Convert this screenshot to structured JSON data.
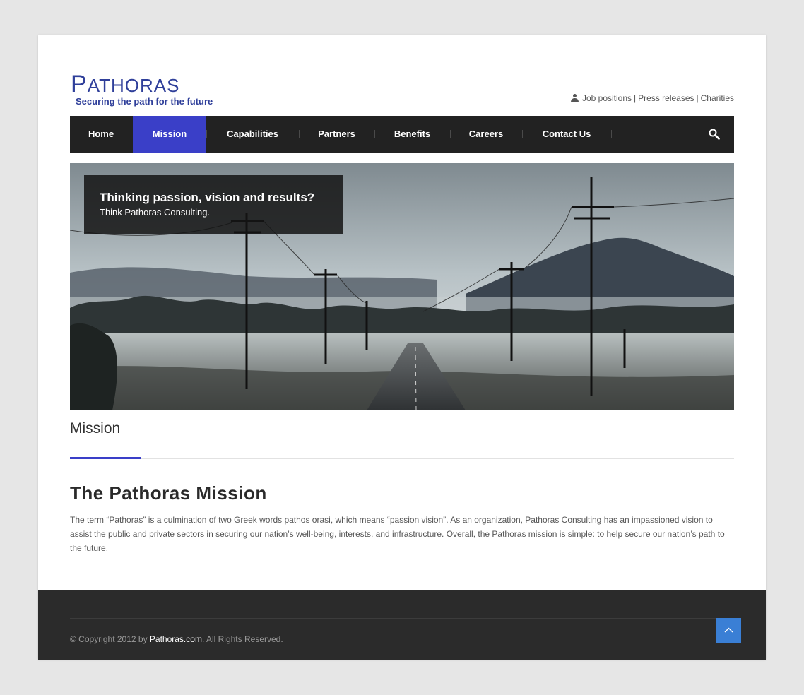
{
  "header": {
    "logo_first_letter": "P",
    "logo_rest": "ATHORAS",
    "logo_tagline": "Securing the path for the future",
    "top_links": [
      "Job positions",
      "Press releases",
      "Charities"
    ],
    "top_link_separator": "|"
  },
  "nav": {
    "items": [
      {
        "label": "Home"
      },
      {
        "label": "Mission"
      },
      {
        "label": "Capabilities"
      },
      {
        "label": "Partners"
      },
      {
        "label": "Benefits"
      },
      {
        "label": "Careers"
      },
      {
        "label": "Contact Us"
      }
    ],
    "active_item": "Mission",
    "search_icon": "search-icon"
  },
  "hero": {
    "caption_title": "Thinking passion, vision and results?",
    "caption_subtitle": "Think Pathoras Consulting."
  },
  "main": {
    "page_title": "Mission",
    "section_title": "The Pathoras Mission",
    "body_text": "The term “Pathoras” is a culmination of two Greek words pathos orasi, which means “passion vision”. As an organization, Pathoras Consulting has an impassioned vision to assist the public and private sectors in securing our nation’s well-being, interests, and infrastructure. Overall, the Pathoras mission is simple: to help secure our nation’s path to the future."
  },
  "footer": {
    "copyright_prefix": "© Copyright 2012 by ",
    "copyright_link": "Pathoras.com",
    "copyright_suffix": ". All Rights Reserved.",
    "back_to_top_icon": "chevron-up-icon"
  },
  "colors": {
    "accent": "#3a3fc8",
    "logo": "#2f3f9a",
    "nav_bg": "#222222",
    "footer_bg": "#2b2b2b",
    "back_to_top": "#3a7fd5"
  }
}
